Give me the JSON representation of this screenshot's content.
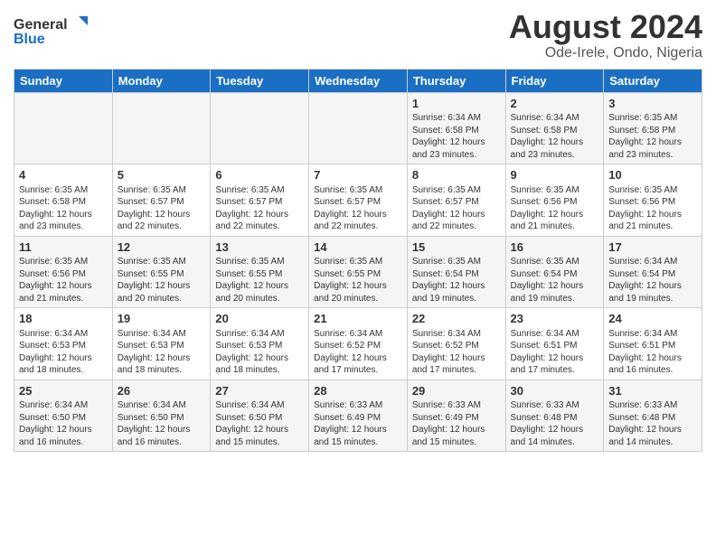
{
  "header": {
    "logo_general": "General",
    "logo_blue": "Blue",
    "month_title": "August 2024",
    "location": "Ode-Irele, Ondo, Nigeria"
  },
  "days_of_week": [
    "Sunday",
    "Monday",
    "Tuesday",
    "Wednesday",
    "Thursday",
    "Friday",
    "Saturday"
  ],
  "weeks": [
    [
      {
        "day": "",
        "info": ""
      },
      {
        "day": "",
        "info": ""
      },
      {
        "day": "",
        "info": ""
      },
      {
        "day": "",
        "info": ""
      },
      {
        "day": "1",
        "info": "Sunrise: 6:34 AM\nSunset: 6:58 PM\nDaylight: 12 hours\nand 23 minutes."
      },
      {
        "day": "2",
        "info": "Sunrise: 6:34 AM\nSunset: 6:58 PM\nDaylight: 12 hours\nand 23 minutes."
      },
      {
        "day": "3",
        "info": "Sunrise: 6:35 AM\nSunset: 6:58 PM\nDaylight: 12 hours\nand 23 minutes."
      }
    ],
    [
      {
        "day": "4",
        "info": "Sunrise: 6:35 AM\nSunset: 6:58 PM\nDaylight: 12 hours\nand 23 minutes."
      },
      {
        "day": "5",
        "info": "Sunrise: 6:35 AM\nSunset: 6:57 PM\nDaylight: 12 hours\nand 22 minutes."
      },
      {
        "day": "6",
        "info": "Sunrise: 6:35 AM\nSunset: 6:57 PM\nDaylight: 12 hours\nand 22 minutes."
      },
      {
        "day": "7",
        "info": "Sunrise: 6:35 AM\nSunset: 6:57 PM\nDaylight: 12 hours\nand 22 minutes."
      },
      {
        "day": "8",
        "info": "Sunrise: 6:35 AM\nSunset: 6:57 PM\nDaylight: 12 hours\nand 22 minutes."
      },
      {
        "day": "9",
        "info": "Sunrise: 6:35 AM\nSunset: 6:56 PM\nDaylight: 12 hours\nand 21 minutes."
      },
      {
        "day": "10",
        "info": "Sunrise: 6:35 AM\nSunset: 6:56 PM\nDaylight: 12 hours\nand 21 minutes."
      }
    ],
    [
      {
        "day": "11",
        "info": "Sunrise: 6:35 AM\nSunset: 6:56 PM\nDaylight: 12 hours\nand 21 minutes."
      },
      {
        "day": "12",
        "info": "Sunrise: 6:35 AM\nSunset: 6:55 PM\nDaylight: 12 hours\nand 20 minutes."
      },
      {
        "day": "13",
        "info": "Sunrise: 6:35 AM\nSunset: 6:55 PM\nDaylight: 12 hours\nand 20 minutes."
      },
      {
        "day": "14",
        "info": "Sunrise: 6:35 AM\nSunset: 6:55 PM\nDaylight: 12 hours\nand 20 minutes."
      },
      {
        "day": "15",
        "info": "Sunrise: 6:35 AM\nSunset: 6:54 PM\nDaylight: 12 hours\nand 19 minutes."
      },
      {
        "day": "16",
        "info": "Sunrise: 6:35 AM\nSunset: 6:54 PM\nDaylight: 12 hours\nand 19 minutes."
      },
      {
        "day": "17",
        "info": "Sunrise: 6:34 AM\nSunset: 6:54 PM\nDaylight: 12 hours\nand 19 minutes."
      }
    ],
    [
      {
        "day": "18",
        "info": "Sunrise: 6:34 AM\nSunset: 6:53 PM\nDaylight: 12 hours\nand 18 minutes."
      },
      {
        "day": "19",
        "info": "Sunrise: 6:34 AM\nSunset: 6:53 PM\nDaylight: 12 hours\nand 18 minutes."
      },
      {
        "day": "20",
        "info": "Sunrise: 6:34 AM\nSunset: 6:53 PM\nDaylight: 12 hours\nand 18 minutes."
      },
      {
        "day": "21",
        "info": "Sunrise: 6:34 AM\nSunset: 6:52 PM\nDaylight: 12 hours\nand 17 minutes."
      },
      {
        "day": "22",
        "info": "Sunrise: 6:34 AM\nSunset: 6:52 PM\nDaylight: 12 hours\nand 17 minutes."
      },
      {
        "day": "23",
        "info": "Sunrise: 6:34 AM\nSunset: 6:51 PM\nDaylight: 12 hours\nand 17 minutes."
      },
      {
        "day": "24",
        "info": "Sunrise: 6:34 AM\nSunset: 6:51 PM\nDaylight: 12 hours\nand 16 minutes."
      }
    ],
    [
      {
        "day": "25",
        "info": "Sunrise: 6:34 AM\nSunset: 6:50 PM\nDaylight: 12 hours\nand 16 minutes."
      },
      {
        "day": "26",
        "info": "Sunrise: 6:34 AM\nSunset: 6:50 PM\nDaylight: 12 hours\nand 16 minutes."
      },
      {
        "day": "27",
        "info": "Sunrise: 6:34 AM\nSunset: 6:50 PM\nDaylight: 12 hours\nand 15 minutes."
      },
      {
        "day": "28",
        "info": "Sunrise: 6:33 AM\nSunset: 6:49 PM\nDaylight: 12 hours\nand 15 minutes."
      },
      {
        "day": "29",
        "info": "Sunrise: 6:33 AM\nSunset: 6:49 PM\nDaylight: 12 hours\nand 15 minutes."
      },
      {
        "day": "30",
        "info": "Sunrise: 6:33 AM\nSunset: 6:48 PM\nDaylight: 12 hours\nand 14 minutes."
      },
      {
        "day": "31",
        "info": "Sunrise: 6:33 AM\nSunset: 6:48 PM\nDaylight: 12 hours\nand 14 minutes."
      }
    ]
  ]
}
